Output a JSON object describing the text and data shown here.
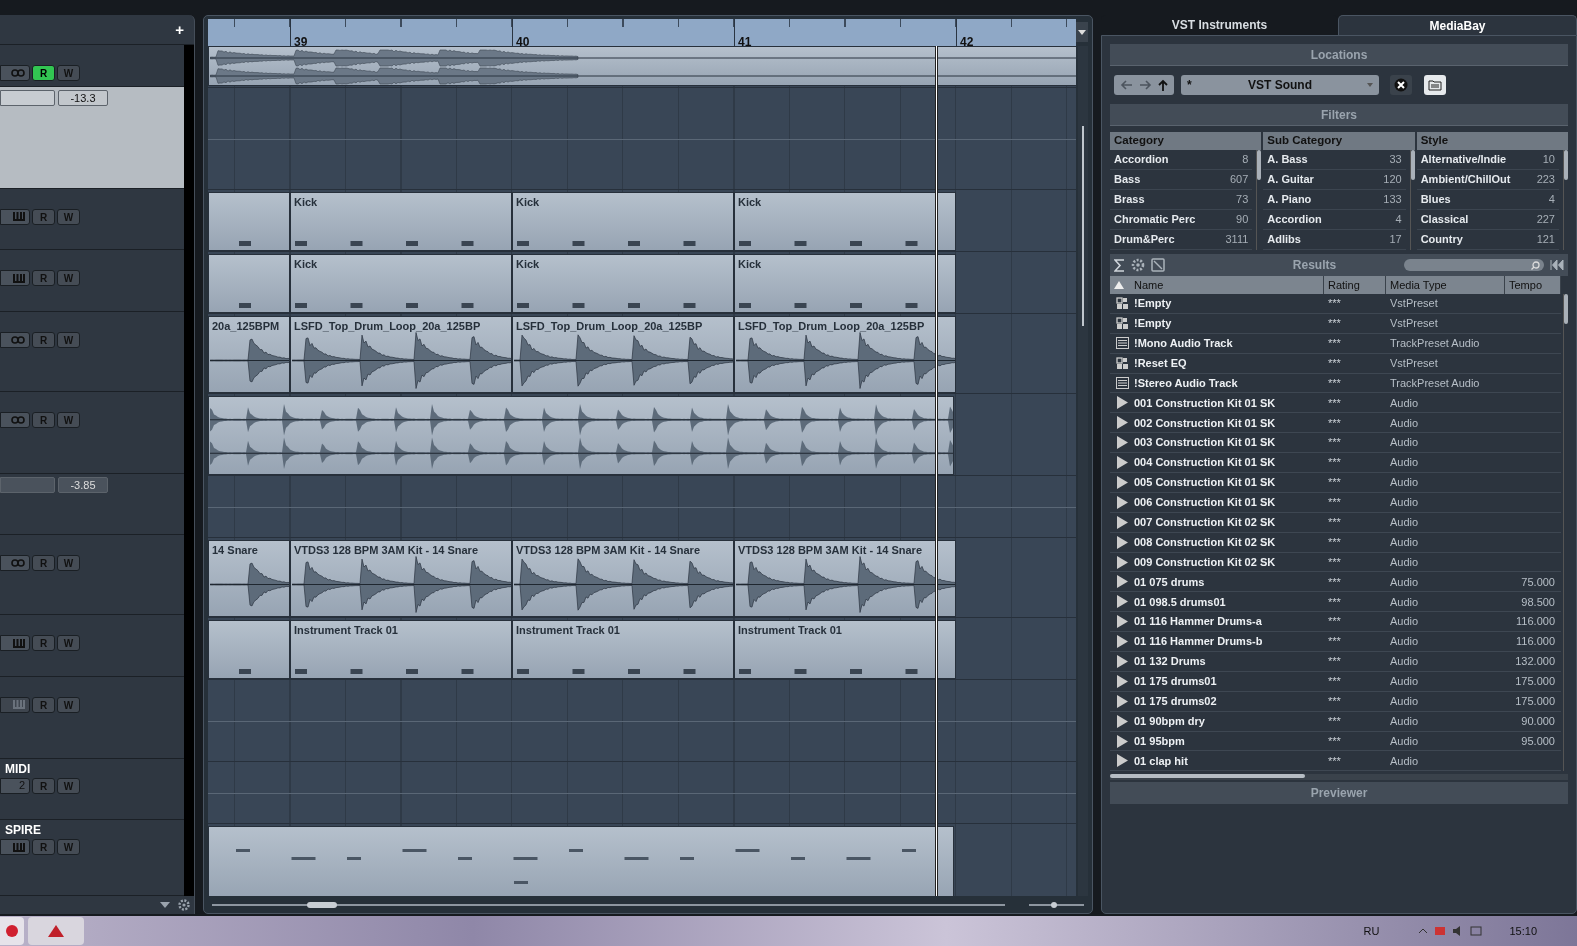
{
  "track_list": {
    "add_button": "+"
  },
  "tracks": [
    {
      "kind": "link",
      "selected": false,
      "buttons": [
        {
          "label": "R",
          "on": true
        },
        {
          "label": "W",
          "on": false
        }
      ],
      "events": [
        {
          "kind": "stereo"
        }
      ]
    },
    {
      "fader": "-13.3",
      "selected": true
    },
    {
      "kind": "midi",
      "selected": false,
      "buttons": [
        {
          "label": "R",
          "on": false
        },
        {
          "label": "W",
          "on": false
        }
      ],
      "events": [
        {
          "kind": "midi"
        },
        {
          "kind": "midi",
          "name": "Kick"
        },
        {
          "kind": "midi",
          "name": "Kick"
        },
        {
          "kind": "midi",
          "name": "Kick"
        }
      ]
    },
    {
      "kind": "midi",
      "selected": false,
      "buttons": [
        {
          "label": "R",
          "on": false
        },
        {
          "label": "W",
          "on": false
        }
      ],
      "events": [
        {
          "kind": "midi"
        },
        {
          "kind": "midi",
          "name": "Kick"
        },
        {
          "kind": "midi",
          "name": "Kick"
        },
        {
          "kind": "midi",
          "name": "Kick"
        }
      ]
    },
    {
      "kind": "link",
      "selected": false,
      "buttons": [
        {
          "label": "R",
          "on": false
        },
        {
          "label": "W",
          "on": false
        }
      ],
      "events": [
        {
          "kind": "audio",
          "name": "20a_125BPM"
        },
        {
          "kind": "audio",
          "name": "LSFD_Top_Drum_Loop_20a_125BP"
        },
        {
          "kind": "audio",
          "name": "LSFD_Top_Drum_Loop_20a_125BP"
        },
        {
          "kind": "audio",
          "name": "LSFD_Top_Drum_Loop_20a_125BP"
        }
      ]
    },
    {
      "kind": "link",
      "selected": false,
      "buttons": [
        {
          "label": "R",
          "on": false
        },
        {
          "label": "W",
          "on": false
        }
      ],
      "events": [
        {
          "kind": "wave"
        }
      ]
    },
    {
      "fader": "-3.85",
      "selected": false
    },
    {
      "kind": "link",
      "selected": false,
      "buttons": [
        {
          "label": "R",
          "on": false
        },
        {
          "label": "W",
          "on": false
        }
      ],
      "events": [
        {
          "kind": "audio",
          "name": "14 Snare"
        },
        {
          "kind": "audio",
          "name": "VTDS3 128 BPM 3AM Kit - 14 Snare"
        },
        {
          "kind": "audio",
          "name": "VTDS3 128 BPM 3AM Kit - 14 Snare"
        },
        {
          "kind": "audio",
          "name": "VTDS3 128 BPM 3AM Kit - 14 Snare"
        }
      ]
    },
    {
      "kind": "midi",
      "selected": false,
      "buttons": [
        {
          "label": "R",
          "on": false
        },
        {
          "label": "W",
          "on": false
        }
      ],
      "events": [
        {
          "kind": "midi"
        },
        {
          "kind": "midi",
          "name": "Instrument Track 01"
        },
        {
          "kind": "midi",
          "name": "Instrument Track 01"
        },
        {
          "kind": "midi",
          "name": "Instrument Track 01"
        }
      ]
    },
    {
      "kind": "midi_off",
      "selected": false,
      "buttons": [
        {
          "label": "R",
          "on": false
        },
        {
          "label": "W",
          "on": false
        }
      ]
    },
    {
      "name": "MIDI",
      "kind": "number",
      "number": "2",
      "selected": false,
      "buttons": [
        {
          "label": "R",
          "on": false
        },
        {
          "label": "W",
          "on": false
        }
      ]
    },
    {
      "name": "SPIRE",
      "kind": "midi",
      "selected": false,
      "buttons": [
        {
          "label": "R",
          "on": false
        },
        {
          "label": "W",
          "on": false
        }
      ],
      "events": [
        {
          "kind": "notes"
        }
      ]
    }
  ],
  "ruler": {
    "bars": [
      "39",
      "40",
      "41",
      "42"
    ]
  },
  "zoom_slider": {
    "level": 0.45
  },
  "tabs": [
    {
      "label": "VST Instruments",
      "selected": false
    },
    {
      "label": "MediaBay",
      "selected": true
    }
  ],
  "locations": {
    "title": "Locations",
    "prefix": "*",
    "path": "VST Sound"
  },
  "filters": {
    "title": "Filters",
    "columns": [
      {
        "header": "Category",
        "items": [
          {
            "name": "Accordion",
            "count": "8"
          },
          {
            "name": "Bass",
            "count": "607"
          },
          {
            "name": "Brass",
            "count": "73"
          },
          {
            "name": "Chromatic Perc",
            "count": "90"
          },
          {
            "name": "Drum&Perc",
            "count": "3111"
          }
        ]
      },
      {
        "header": "Sub Category",
        "items": [
          {
            "name": "A. Bass",
            "count": "33"
          },
          {
            "name": "A. Guitar",
            "count": "120"
          },
          {
            "name": "A. Piano",
            "count": "133"
          },
          {
            "name": "Accordion",
            "count": "4"
          },
          {
            "name": "Adlibs",
            "count": "17"
          }
        ]
      },
      {
        "header": "Style",
        "items": [
          {
            "name": "Alternative/Indie",
            "count": "10"
          },
          {
            "name": "Ambient/ChillOut",
            "count": "223"
          },
          {
            "name": "Blues",
            "count": "4"
          },
          {
            "name": "Classical",
            "count": "227"
          },
          {
            "name": "Country",
            "count": "121"
          }
        ]
      }
    ]
  },
  "results": {
    "title": "Results",
    "columns": [
      "Name",
      "Rating",
      "Media Type",
      "Tempo"
    ],
    "rows": [
      {
        "kind": "preset",
        "name": "!Empty",
        "rating": "***",
        "type": "VstPreset"
      },
      {
        "kind": "preset",
        "name": "!Empty",
        "rating": "***",
        "type": "VstPreset"
      },
      {
        "kind": "track",
        "name": "!Mono Audio Track",
        "rating": "***",
        "type": "TrackPreset Audio"
      },
      {
        "kind": "preset",
        "name": "!Reset EQ",
        "rating": "***",
        "type": "VstPreset"
      },
      {
        "kind": "track",
        "name": "!Stereo Audio Track",
        "rating": "***",
        "type": "TrackPreset Audio"
      },
      {
        "kind": "audio",
        "name": "001 Construction Kit 01 SK",
        "rating": "***",
        "type": "Audio"
      },
      {
        "kind": "audio",
        "name": "002 Construction Kit 01 SK",
        "rating": "***",
        "type": "Audio"
      },
      {
        "kind": "audio",
        "name": "003 Construction Kit 01 SK",
        "rating": "***",
        "type": "Audio"
      },
      {
        "kind": "audio",
        "name": "004 Construction Kit 01 SK",
        "rating": "***",
        "type": "Audio"
      },
      {
        "kind": "audio",
        "name": "005 Construction Kit 01 SK",
        "rating": "***",
        "type": "Audio"
      },
      {
        "kind": "audio",
        "name": "006 Construction Kit 01 SK",
        "rating": "***",
        "type": "Audio"
      },
      {
        "kind": "audio",
        "name": "007 Construction Kit 02 SK",
        "rating": "***",
        "type": "Audio"
      },
      {
        "kind": "audio",
        "name": "008 Construction Kit 02 SK",
        "rating": "***",
        "type": "Audio"
      },
      {
        "kind": "audio",
        "name": "009 Construction Kit 02 SK",
        "rating": "***",
        "type": "Audio"
      },
      {
        "kind": "audio",
        "name": "01 075 drums",
        "rating": "***",
        "type": "Audio",
        "tempo": "75.000"
      },
      {
        "kind": "audio",
        "name": "01 098.5 drums01",
        "rating": "***",
        "type": "Audio",
        "tempo": "98.500"
      },
      {
        "kind": "audio",
        "name": "01 116 Hammer Drums-a",
        "rating": "***",
        "type": "Audio",
        "tempo": "116.000"
      },
      {
        "kind": "audio",
        "name": "01 116 Hammer Drums-b",
        "rating": "***",
        "type": "Audio",
        "tempo": "116.000"
      },
      {
        "kind": "audio",
        "name": "01 132 Drums",
        "rating": "***",
        "type": "Audio",
        "tempo": "132.000"
      },
      {
        "kind": "audio",
        "name": "01 175 drums01",
        "rating": "***",
        "type": "Audio",
        "tempo": "175.000"
      },
      {
        "kind": "audio",
        "name": "01 175 drums02",
        "rating": "***",
        "type": "Audio",
        "tempo": "175.000"
      },
      {
        "kind": "audio",
        "name": "01 90bpm dry",
        "rating": "***",
        "type": "Audio",
        "tempo": "90.000"
      },
      {
        "kind": "audio",
        "name": "01 95bpm",
        "rating": "***",
        "type": "Audio",
        "tempo": "95.000"
      },
      {
        "kind": "audio",
        "name": "01 clap hit",
        "rating": "***",
        "type": "Audio"
      }
    ]
  },
  "previewer": {
    "title": "Previewer"
  },
  "taskbar": {
    "language": "RU",
    "time": "15:10"
  }
}
